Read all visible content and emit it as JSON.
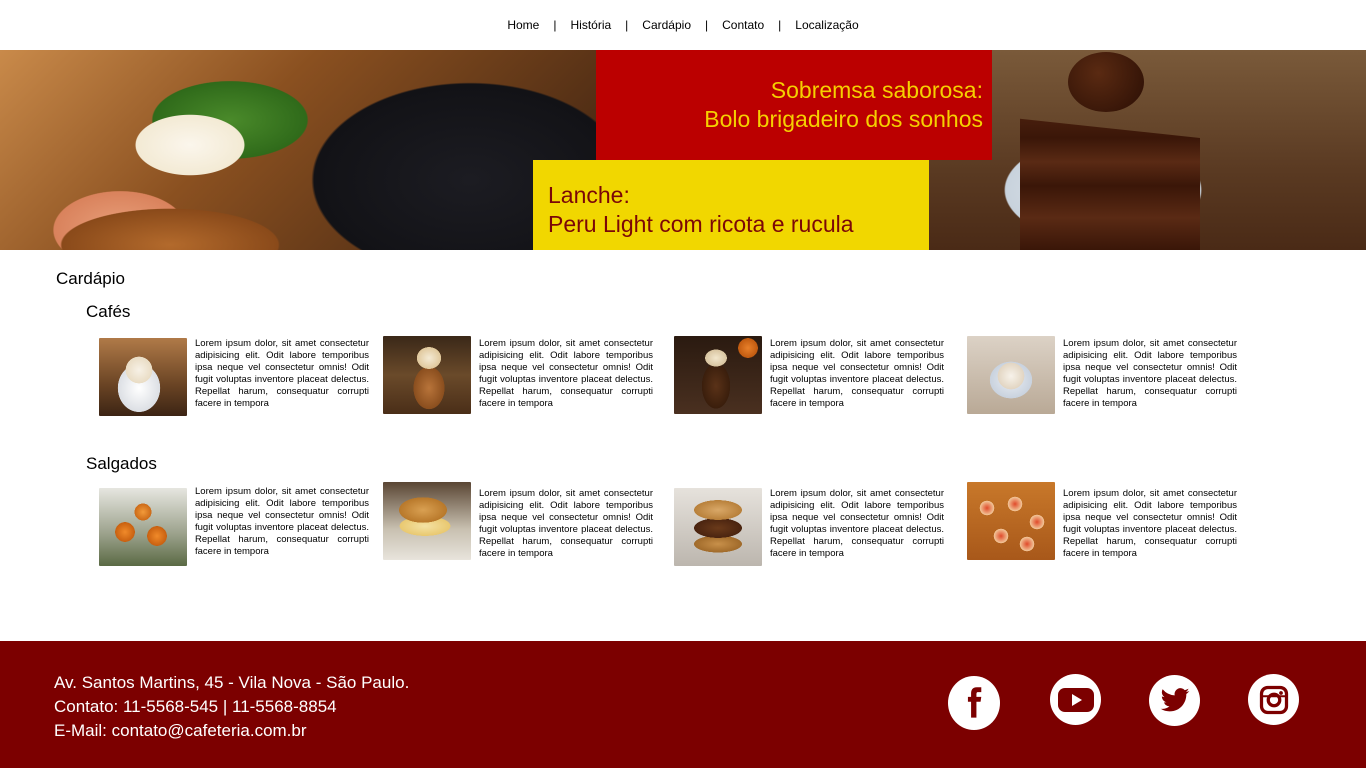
{
  "nav": {
    "items": [
      "Home",
      "História",
      "Cardápio",
      "Contato",
      "Localização"
    ],
    "separator": "|"
  },
  "hero": {
    "red_box": {
      "line1": "Sobremsa saborosa:",
      "line2": "Bolo brigadeiro dos sonhos"
    },
    "yellow_box": {
      "line1": "Lanche:",
      "line2": "Peru Light com ricota e rucula"
    }
  },
  "menu": {
    "title": "Cardápio",
    "categories": [
      {
        "name": "Cafés",
        "items": [
          {
            "text": "Lorem ipsum dolor, sit amet consectetur adipisicing elit. Odit labore temporibus ipsa neque vel consectetur omnis! Odit fugit voluptas inventore placeat delectus. Repellat harum, consequatur corrupti facere in tempora"
          },
          {
            "text": "Lorem ipsum dolor, sit amet consectetur adipisicing elit. Odit labore temporibus ipsa neque vel consectetur omnis! Odit fugit voluptas inventore placeat delectus. Repellat harum, consequatur corrupti facere in tempora"
          },
          {
            "text": "Lorem ipsum dolor, sit amet consectetur adipisicing elit. Odit labore temporibus ipsa neque vel consectetur omnis! Odit fugit voluptas inventore placeat delectus. Repellat harum, consequatur corrupti facere in tempora"
          },
          {
            "text": "Lorem ipsum dolor, sit amet consectetur adipisicing elit. Odit labore temporibus ipsa neque vel consectetur omnis! Odit fugit voluptas inventore placeat delectus. Repellat harum, consequatur corrupti facere in tempora"
          }
        ]
      },
      {
        "name": "Salgados",
        "items": [
          {
            "text": "Lorem ipsum dolor, sit amet consectetur adipisicing elit. Odit labore temporibus ipsa neque vel consectetur omnis! Odit fugit voluptas inventore placeat delectus. Repellat harum, consequatur corrupti facere in tempora"
          },
          {
            "text": "Lorem ipsum dolor, sit amet consectetur adipisicing elit. Odit labore temporibus ipsa neque vel consectetur omnis! Odit fugit voluptas inventore placeat delectus. Repellat harum, consequatur corrupti facere in tempora"
          },
          {
            "text": "Lorem ipsum dolor, sit amet consectetur adipisicing elit. Odit labore temporibus ipsa neque vel consectetur omnis! Odit fugit voluptas inventore placeat delectus. Repellat harum, consequatur corrupti facere in tempora"
          },
          {
            "text": "Lorem ipsum dolor, sit amet consectetur adipisicing elit. Odit labore temporibus ipsa neque vel consectetur omnis! Odit fugit voluptas inventore placeat delectus. Repellat harum, consequatur corrupti facere in tempora"
          }
        ]
      }
    ]
  },
  "footer": {
    "address": "Av. Santos Martins, 45 - Vila Nova - São Paulo.",
    "contact": "Contato: 11-5568-545 | 11-5568-8854",
    "email": "E-Mail: contato@cafeteria.com.br",
    "social": [
      "facebook-icon",
      "youtube-icon",
      "twitter-icon",
      "instagram-icon"
    ]
  },
  "colors": {
    "red_box": "#bb0000",
    "red_box_text": "#f5d000",
    "yellow_box": "#f1d700",
    "yellow_box_text": "#7b0707",
    "footer_bg": "#7c0000"
  }
}
